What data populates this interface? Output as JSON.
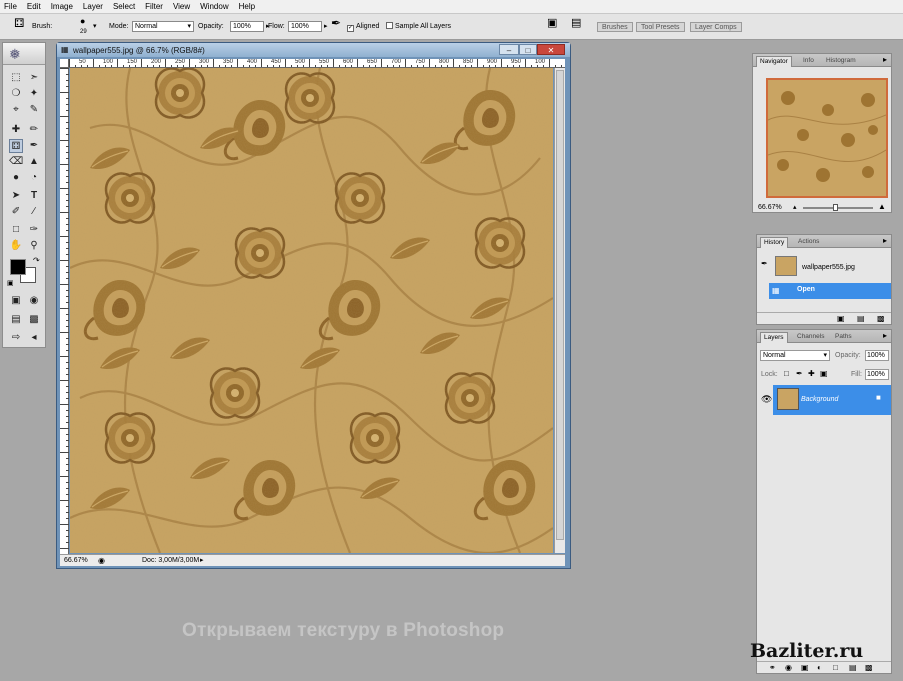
{
  "menu": [
    "File",
    "Edit",
    "Image",
    "Layer",
    "Select",
    "Filter",
    "View",
    "Window",
    "Help"
  ],
  "options_bar": {
    "brush_label": "Brush:",
    "brush_size": "29",
    "mode_label": "Mode:",
    "mode_value": "Normal",
    "opacity_label": "Opacity:",
    "opacity_value": "100%",
    "flow_label": "Flow:",
    "flow_value": "100%",
    "aligned_label": "Aligned",
    "sample_all_label": "Sample All Layers",
    "well_tabs": [
      "Brushes",
      "Tool Presets",
      "Layer Comps"
    ]
  },
  "document": {
    "title": "wallpaper555.jpg @ 66.7% (RGB/8#)",
    "ruler_ticks": [
      "50",
      "100",
      "150",
      "200",
      "250",
      "300",
      "350",
      "400",
      "450",
      "500",
      "550",
      "600",
      "650",
      "700",
      "750",
      "800",
      "850",
      "900",
      "950",
      "100"
    ],
    "zoom": "66.67%",
    "doc_size": "Doc: 3,00M/3,00M"
  },
  "navigator": {
    "tabs": [
      "Navigator",
      "Info",
      "Histogram"
    ],
    "zoom": "66.67%"
  },
  "history": {
    "tabs": [
      "History",
      "Actions"
    ],
    "snapshot_name": "wallpaper555.jpg",
    "state": "Open"
  },
  "layers": {
    "tabs": [
      "Layers",
      "Channels",
      "Paths"
    ],
    "blend_mode": "Normal",
    "opacity_label": "Opacity:",
    "opacity_value": "100%",
    "lock_label": "Lock:",
    "fill_label": "Fill:",
    "fill_value": "100%",
    "layer_name": "Background"
  },
  "caption": "Открываем текстуру в Photoshop",
  "brand": "Bazliter.ru",
  "colors": {
    "texture_base": "#c9a463",
    "texture_motif": "#9a7231",
    "selection_blue": "#3c8ee8",
    "workspace_gray": "#a7a7a7"
  },
  "icons": [
    "clone-stamp-icon",
    "airbrush-icon",
    "eye-icon",
    "lock-icon",
    "minimize-icon",
    "maximize-icon",
    "close-icon"
  ]
}
